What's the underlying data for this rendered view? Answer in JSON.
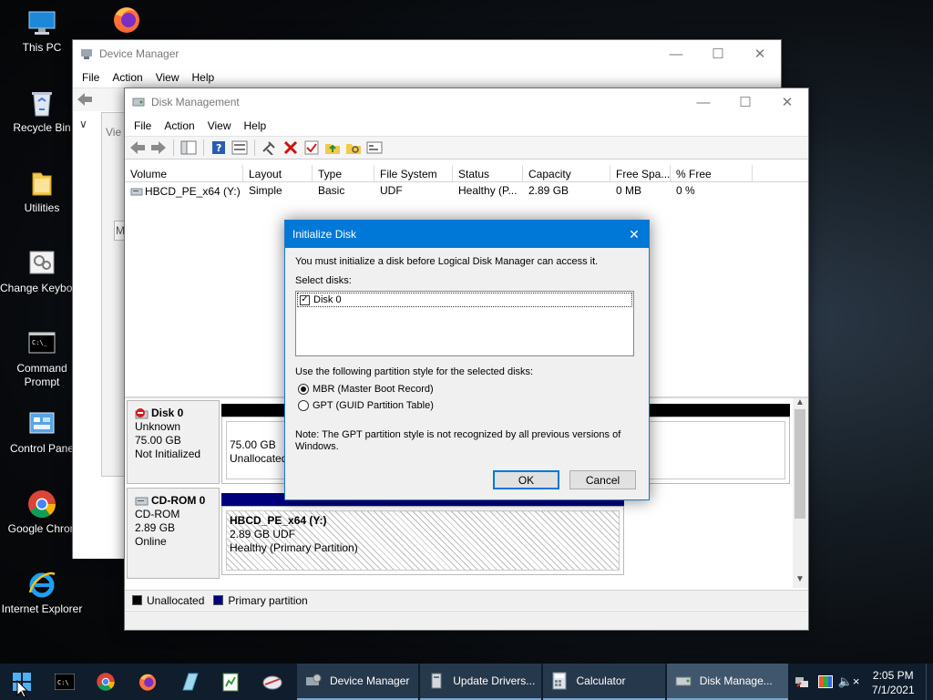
{
  "desktop": {
    "icons": [
      {
        "label": "This PC",
        "icon": "this-pc-icon"
      },
      {
        "label": "Recycle Bin",
        "icon": "recycle-bin-icon"
      },
      {
        "label": "Utilities",
        "icon": "folder-icon"
      },
      {
        "label": "Change Keyboard Layo",
        "icon": "keyboard-layout-icon"
      },
      {
        "label": "Command Prompt",
        "icon": "command-prompt-icon"
      },
      {
        "label": "Control Pane",
        "icon": "control-panel-icon"
      },
      {
        "label": "Google Chron",
        "icon": "chrome-icon"
      },
      {
        "label": "Internet Explorer",
        "icon": "internet-explorer-icon"
      },
      {
        "label": "",
        "icon": "firefox-icon"
      }
    ]
  },
  "device_manager": {
    "title": "Device Manager",
    "menu": [
      "File",
      "Action",
      "View",
      "Help"
    ],
    "partial_label": "Vie",
    "partial_letter": "M"
  },
  "disk_management": {
    "title": "Disk Management",
    "menu": [
      "File",
      "Action",
      "View",
      "Help"
    ],
    "columns": [
      "Volume",
      "Layout",
      "Type",
      "File System",
      "Status",
      "Capacity",
      "Free Spa...",
      "% Free"
    ],
    "volumes": [
      {
        "volume": "HBCD_PE_x64 (Y:)",
        "layout": "Simple",
        "type": "Basic",
        "fs": "UDF",
        "status": "Healthy (P...",
        "capacity": "2.89 GB",
        "free": "0 MB",
        "pct": "0 %"
      }
    ],
    "disks": [
      {
        "name": "Disk 0",
        "line1": "Unknown",
        "line2": "75.00 GB",
        "line3": "Not Initialized",
        "partition": {
          "size": "75.00 GB",
          "label": "Unallocated"
        }
      },
      {
        "name": "CD-ROM 0",
        "line1": "CD-ROM",
        "line2": "2.89 GB",
        "line3": "Online",
        "partition": {
          "name": "HBCD_PE_x64  (Y:)",
          "size_fs": "2.89 GB UDF",
          "status": "Healthy (Primary Partition)"
        }
      }
    ],
    "legend": [
      {
        "label": "Unallocated",
        "color": "#000000"
      },
      {
        "label": "Primary partition",
        "color": "#00007f"
      }
    ]
  },
  "dialog": {
    "title": "Initialize Disk",
    "message": "You must initialize a disk before Logical Disk Manager can access it.",
    "select_label": "Select disks:",
    "disks": [
      {
        "label": "Disk 0",
        "checked": true
      }
    ],
    "style_label": "Use the following partition style for the selected disks:",
    "options": [
      {
        "label": "MBR (Master Boot Record)",
        "selected": true
      },
      {
        "label": "GPT (GUID Partition Table)",
        "selected": false
      }
    ],
    "note": "Note: The GPT partition style is not recognized by all previous versions of Windows.",
    "ok": "OK",
    "cancel": "Cancel"
  },
  "taskbar": {
    "tasks": [
      {
        "label": "Device Manager",
        "icon": "device-manager-icon",
        "active": false
      },
      {
        "label": "Update Drivers...",
        "icon": "update-drivers-icon",
        "active": false
      },
      {
        "label": "Calculator",
        "icon": "calculator-icon",
        "active": false
      },
      {
        "label": "Disk Manage...",
        "icon": "disk-management-icon",
        "active": true
      }
    ],
    "time": "2:05 PM",
    "date": "7/1/2021"
  },
  "colors": {
    "accent": "#0078d7",
    "unallocated": "#000000",
    "primary_partition": "#00007f"
  }
}
